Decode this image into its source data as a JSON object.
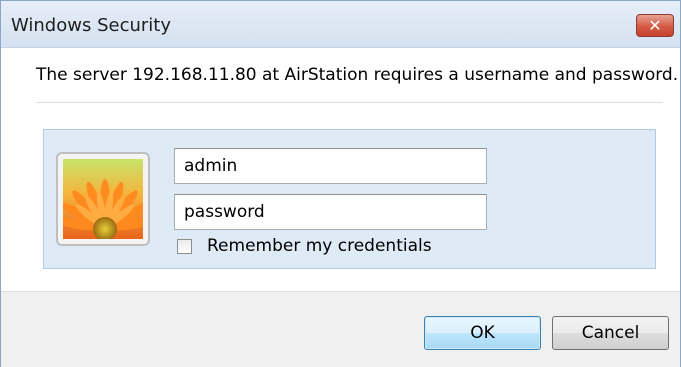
{
  "window": {
    "title": "Windows Security",
    "close_label": "✕"
  },
  "message": "The server 192.168.11.80 at AirStation requires a username and password.",
  "credentials": {
    "username_value": "admin",
    "password_value": "password",
    "remember_label": "Remember my credentials",
    "remember_checked": false,
    "avatar_icon": "flower-user-tile-icon"
  },
  "buttons": {
    "ok_label": "OK",
    "cancel_label": "Cancel"
  },
  "colors": {
    "titlebar": "#dde7f3",
    "panel": "#dfeaf7",
    "close_button": "#d45a45",
    "ok_border": "#3c7fb1"
  }
}
